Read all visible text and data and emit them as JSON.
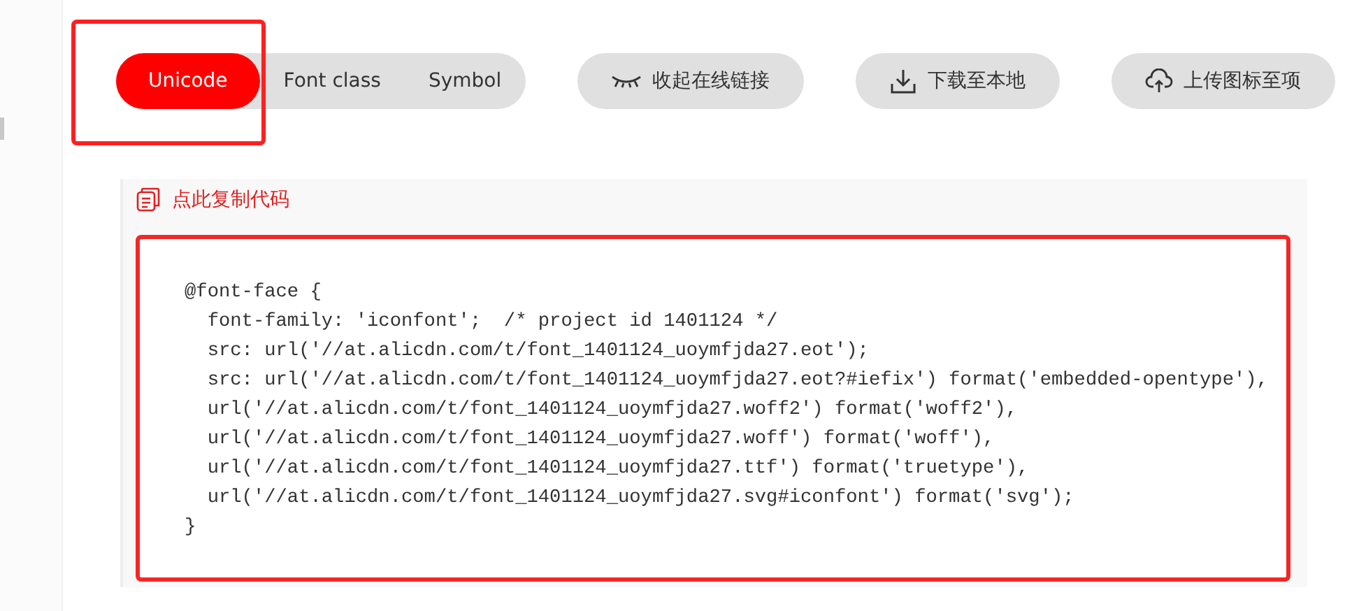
{
  "tabs": [
    {
      "label": "Unicode",
      "selected": true
    },
    {
      "label": "Font class",
      "selected": false
    },
    {
      "label": "Symbol",
      "selected": false
    }
  ],
  "actions": [
    {
      "kind": "eye",
      "label": "收起在线链接"
    },
    {
      "kind": "download",
      "label": "下载至本地"
    },
    {
      "kind": "upload",
      "label": "上传图标至项"
    }
  ],
  "copy_link": {
    "label": "点此复制代码"
  },
  "code": {
    "lines": [
      "@font-face {",
      "  font-family: 'iconfont';  /* project id 1401124 */",
      "  src: url('//at.alicdn.com/t/font_1401124_uoymfjda27.eot');",
      "  src: url('//at.alicdn.com/t/font_1401124_uoymfjda27.eot?#iefix') format('embedded-opentype'),",
      "  url('//at.alicdn.com/t/font_1401124_uoymfjda27.woff2') format('woff2'),",
      "  url('//at.alicdn.com/t/font_1401124_uoymfjda27.woff') format('woff'),",
      "  url('//at.alicdn.com/t/font_1401124_uoymfjda27.ttf') format('truetype'),",
      "  url('//at.alicdn.com/t/font_1401124_uoymfjda27.svg#iconfont') format('svg');",
      "}"
    ]
  }
}
